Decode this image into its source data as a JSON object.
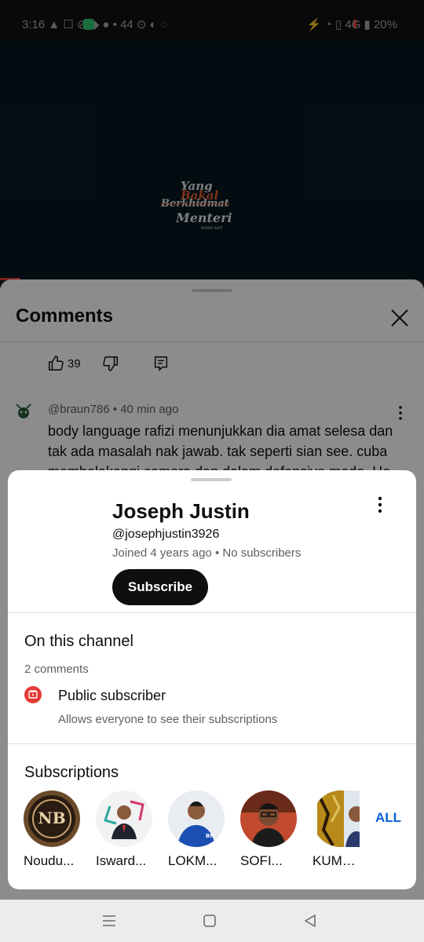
{
  "status_bar": {
    "left_text": "3:16 ▲ ☐ ⊘ ◆ ● • 44 ⊙ ◐ ◌",
    "right_text": "⚡ ◔ ▯ 4G ▮ 20%"
  },
  "video": {
    "logo": {
      "line1": "Yang",
      "line2": "Bakal",
      "line3": "Berkhidmat",
      "line4": "Menteri",
      "line5": "PODCAST"
    }
  },
  "comments": {
    "title": "Comments",
    "like_count": "39",
    "comment": {
      "author": "@braun786",
      "time": "40 min ago",
      "text": "body language rafizi menunjukkan dia amat selesa dan tak ada masalah nak jawab. tak seperti sian see. cuba membelakangi camera dan dalam defensive mode. He"
    }
  },
  "channel_card": {
    "name": "Joseph Justin",
    "handle": "@josephjustin3926",
    "joined": "Joined 4 years ago",
    "subscribers": "No subscribers",
    "subscribe_label": "Subscribe",
    "on_this_channel_title": "On this channel",
    "comments_count": "2 comments",
    "public_subscriber_title": "Public subscriber",
    "public_subscriber_desc": "Allows everyone to see their subscriptions",
    "subscriptions_title": "Subscriptions",
    "subscriptions": [
      {
        "label": "Noudu...",
        "icon": "nb-logo-avatar"
      },
      {
        "label": "Isward...",
        "icon": "iswardi-avatar"
      },
      {
        "label": "LOKM...",
        "icon": "lokman-avatar"
      },
      {
        "label": "SOFI...",
        "icon": "sofi-avatar"
      },
      {
        "label": "KUMB...",
        "icon": "kumb-avatar"
      }
    ],
    "all_label": "ALL"
  },
  "colors": {
    "accent_link": "#065fd4",
    "subscribe_bg": "#0f0f0f",
    "youtube_red": "#e53935"
  }
}
